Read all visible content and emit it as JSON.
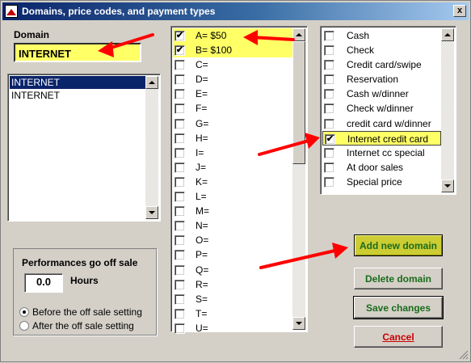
{
  "window": {
    "title": "Domains, price codes, and payment types",
    "close_glyph": "x"
  },
  "domain": {
    "label": "Domain",
    "value": "INTERNET",
    "list": [
      {
        "label": "INTERNET",
        "selected": true
      },
      {
        "label": "INTERNET",
        "selected": false
      }
    ]
  },
  "price_codes": [
    {
      "label": "A= $50",
      "checked": true,
      "highlighted": true
    },
    {
      "label": "B= $100",
      "checked": true,
      "highlighted": true
    },
    {
      "label": "C=",
      "checked": false
    },
    {
      "label": "D=",
      "checked": false
    },
    {
      "label": "E=",
      "checked": false
    },
    {
      "label": "F=",
      "checked": false
    },
    {
      "label": "G=",
      "checked": false
    },
    {
      "label": "H=",
      "checked": false
    },
    {
      "label": "I=",
      "checked": false
    },
    {
      "label": "J=",
      "checked": false
    },
    {
      "label": "K=",
      "checked": false
    },
    {
      "label": "L=",
      "checked": false
    },
    {
      "label": "M=",
      "checked": false
    },
    {
      "label": "N=",
      "checked": false
    },
    {
      "label": "O=",
      "checked": false
    },
    {
      "label": "P=",
      "checked": false
    },
    {
      "label": "Q=",
      "checked": false
    },
    {
      "label": "R=",
      "checked": false
    },
    {
      "label": "S=",
      "checked": false
    },
    {
      "label": "T=",
      "checked": false
    },
    {
      "label": "U=",
      "checked": false
    }
  ],
  "payment_types": [
    {
      "label": "Cash",
      "checked": false
    },
    {
      "label": "Check",
      "checked": false
    },
    {
      "label": "Credit card/swipe",
      "checked": false
    },
    {
      "label": "Reservation",
      "checked": false
    },
    {
      "label": "Cash w/dinner",
      "checked": false
    },
    {
      "label": "Check w/dinner",
      "checked": false
    },
    {
      "label": "credit card w/dinner",
      "checked": false
    },
    {
      "label": "Internet credit card",
      "checked": true,
      "highlighted": true
    },
    {
      "label": "Internet cc special",
      "checked": false
    },
    {
      "label": "At door sales",
      "checked": false
    },
    {
      "label": "Special price",
      "checked": false
    }
  ],
  "offsale": {
    "title": "Performances go off sale",
    "hours_value": "0.0",
    "hours_label": "Hours",
    "options": [
      {
        "label": "Before the off sale setting",
        "selected": true
      },
      {
        "label": "After the off sale setting",
        "selected": false
      }
    ]
  },
  "buttons": {
    "add": "Add new domain",
    "delete": "Delete domain",
    "save": "Save changes",
    "cancel": "Cancel"
  },
  "colors": {
    "highlight": "#ffff66",
    "button_text": "#1a6b1a",
    "cancel_text": "#cc0000",
    "annotation_arrow": "#ff0000",
    "title_bar": "#0a246a"
  },
  "icons": {
    "app": "app-icon",
    "close": "close-icon",
    "check": "checkmark-icon"
  }
}
